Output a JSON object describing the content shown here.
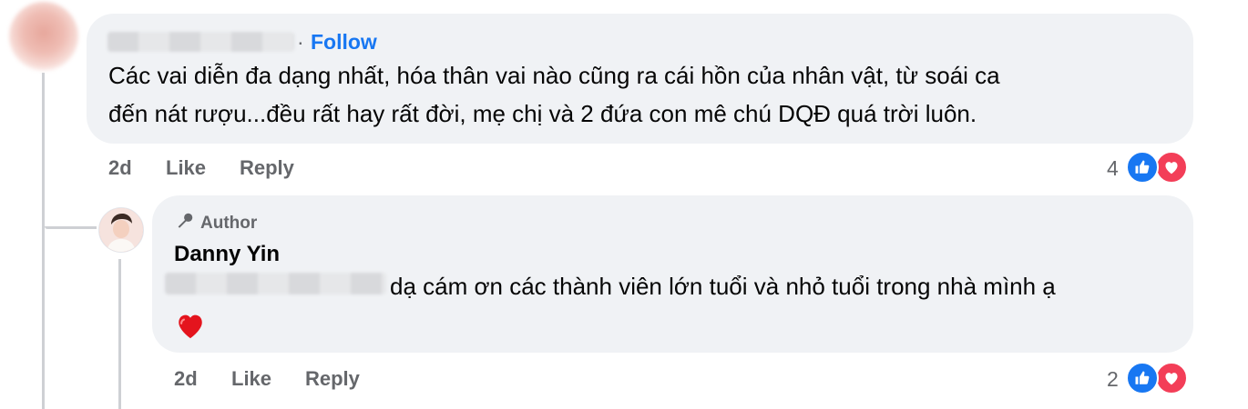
{
  "comment": {
    "follow_label": "Follow",
    "text_line1": "Các vai diễn đa dạng nhất, hóa thân vai nào cũng ra cái hồn của nhân vật, từ soái ca",
    "text_line2": "đến nát rượu...đều rất hay rất đời, mẹ chị và 2 đứa con mê chú DQĐ quá trời luôn.",
    "time": "2d",
    "like_label": "Like",
    "reply_label": "Reply",
    "reaction_count": "4"
  },
  "reply": {
    "badge": "Author",
    "author": "Danny Yin",
    "text": "dạ cám ơn các thành viên lớn tuổi và nhỏ tuổi trong nhà mình ạ",
    "time": "2d",
    "like_label": "Like",
    "reply_label": "Reply",
    "reaction_count": "2"
  },
  "icons": {
    "like": "like-icon",
    "love": "love-icon",
    "mic": "microphone-icon",
    "heart": "red-heart-emoji"
  },
  "colors": {
    "accent": "#1877f2",
    "bubble": "#f0f2f5",
    "secondary_text": "#65676b",
    "love": "#f33e58"
  }
}
